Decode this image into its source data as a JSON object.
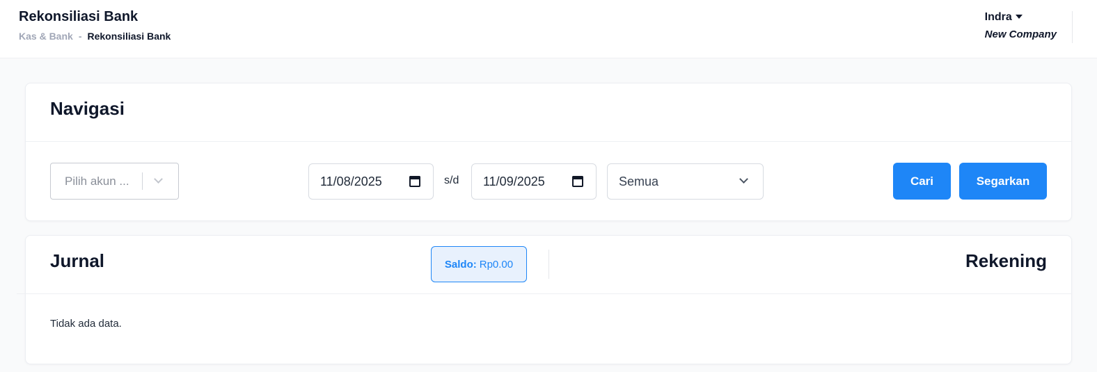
{
  "header": {
    "title": "Rekonsiliasi Bank",
    "breadcrumb": {
      "parent": "Kas & Bank",
      "separator": "-",
      "current": "Rekonsiliasi Bank"
    },
    "user": {
      "name": "Indra",
      "company": "New Company"
    }
  },
  "navigation": {
    "title": "Navigasi",
    "account_select": {
      "placeholder": "Pilih akun ..."
    },
    "date_from": "11/08/2025",
    "range_separator": "s/d",
    "date_to": "11/09/2025",
    "status_select": {
      "value": "Semua"
    },
    "search_button": "Cari",
    "refresh_button": "Segarkan"
  },
  "journal": {
    "title": "Jurnal",
    "saldo_label": "Saldo:",
    "saldo_value": "Rp0.00",
    "account_title": "Rekening",
    "empty_message": "Tidak ada data."
  },
  "colors": {
    "primary": "#1e86f7",
    "badge_bg": "#e8f1fd",
    "text": "#0f172a",
    "muted": "#a1a7b7"
  }
}
